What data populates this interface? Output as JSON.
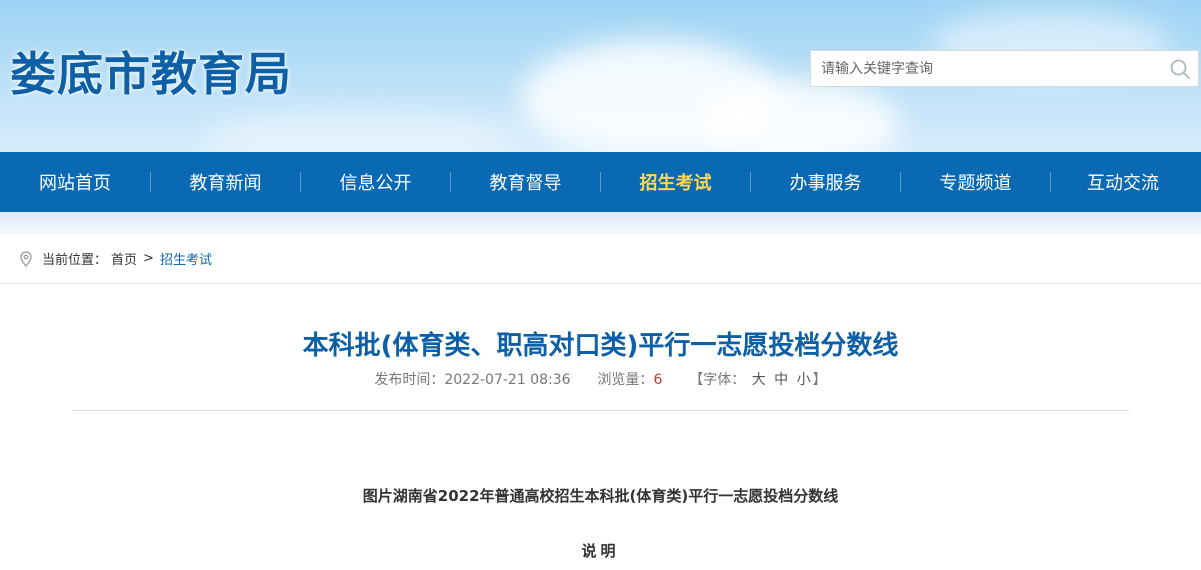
{
  "header": {
    "site_title": "娄底市教育局",
    "search_placeholder": "请输入关键字查询"
  },
  "nav": {
    "items": [
      {
        "label": "网站首页",
        "active": false
      },
      {
        "label": "教育新闻",
        "active": false
      },
      {
        "label": "信息公开",
        "active": false
      },
      {
        "label": "教育督导",
        "active": false
      },
      {
        "label": "招生考试",
        "active": true
      },
      {
        "label": "办事服务",
        "active": false
      },
      {
        "label": "专题频道",
        "active": false
      },
      {
        "label": "互动交流",
        "active": false
      }
    ]
  },
  "breadcrumb": {
    "prefix": "当前位置：",
    "home": "首页",
    "separator": ">",
    "current": "招生考试"
  },
  "article": {
    "title": "本科批(体育类、职高对口类)平行一志愿投档分数线",
    "publish_label": "发布时间：",
    "publish_time": "2022-07-21 08:36",
    "views_label": "浏览量：",
    "views": "6",
    "font_open": "【字体：",
    "font_large": "大",
    "font_medium": "中",
    "font_small": "小",
    "font_close": "】",
    "paragraph1": "图片湖南省2022年普通高校招生本科批(体育类)平行一志愿投档分数线",
    "paragraph2": "说明"
  },
  "colors": {
    "nav_bg": "#0a69b3",
    "title_blue": "#0d5fa6",
    "active_nav": "#ffd84d",
    "views_red": "#c0392b"
  }
}
